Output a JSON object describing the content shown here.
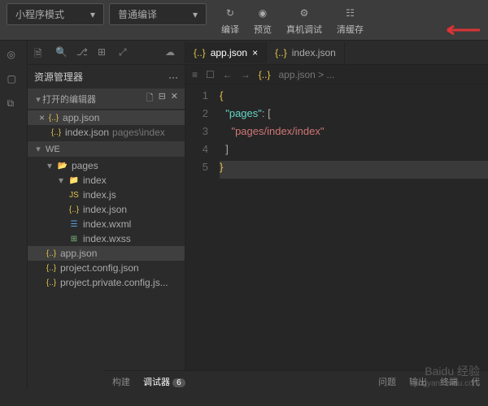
{
  "topbar": {
    "mode_label": "小程序模式",
    "translate_label": "普通编译",
    "actions": {
      "compile": "编译",
      "preview": "预览",
      "debug": "真机调试",
      "clearcache": "清缓存"
    }
  },
  "sidebar": {
    "title": "资源管理器",
    "more": "···",
    "open_editors": {
      "header": "打开的编辑器",
      "items": [
        {
          "close": "×",
          "icon": "{..}",
          "name": "app.json",
          "dim": ""
        },
        {
          "close": "",
          "icon": "{..}",
          "name": "index.json",
          "dim": "pages\\index"
        }
      ]
    },
    "project": {
      "header": "WE",
      "tree": [
        {
          "depth": 1,
          "kind": "folder-open",
          "name": "pages",
          "chev": "▾"
        },
        {
          "depth": 2,
          "kind": "folder",
          "name": "index",
          "chev": "▾"
        },
        {
          "depth": 3,
          "kind": "js",
          "name": "index.js"
        },
        {
          "depth": 3,
          "kind": "json",
          "name": "index.json"
        },
        {
          "depth": 3,
          "kind": "wxml",
          "name": "index.wxml"
        },
        {
          "depth": 3,
          "kind": "wxss",
          "name": "index.wxss"
        },
        {
          "depth": 1,
          "kind": "json",
          "name": "app.json",
          "active": true
        },
        {
          "depth": 1,
          "kind": "json",
          "name": "project.config.json"
        },
        {
          "depth": 1,
          "kind": "json",
          "name": "project.private.config.js..."
        }
      ]
    }
  },
  "editor": {
    "tabs": [
      {
        "icon": "{..}",
        "name": "app.json",
        "active": true,
        "close": "×"
      },
      {
        "icon": "{..}",
        "name": "index.json",
        "active": false
      }
    ],
    "breadcrumb": {
      "icon": "{..}",
      "text": "app.json > ..."
    },
    "lines": [
      "1",
      "2",
      "3",
      "4",
      "5"
    ],
    "code": {
      "l1": "{",
      "l2_key": "\"pages\"",
      "l2_pun": ": [",
      "l3_str": "\"pages/index/index\"",
      "l4": "]",
      "l5": "}"
    }
  },
  "bottombar": {
    "build": "构建",
    "debugger": "调试器",
    "debugger_count": "6",
    "tabs_right": [
      "问题",
      "输出",
      "终端",
      "代"
    ]
  },
  "watermark": {
    "brand": "Baidu 经验",
    "url": "jingyan.baidu.com"
  }
}
